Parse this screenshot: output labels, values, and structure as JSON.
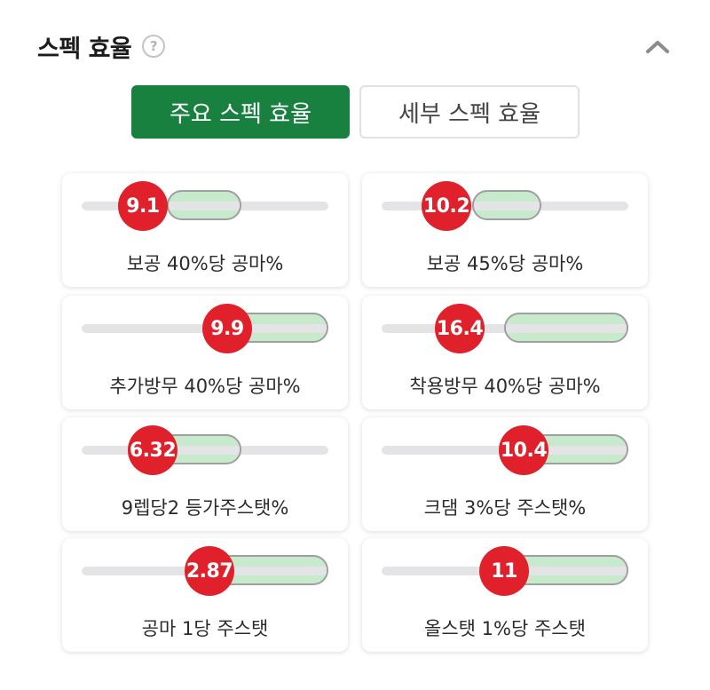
{
  "header": {
    "title": "스펙 효율",
    "help_icon": "?"
  },
  "tabs": [
    {
      "label": "주요 스펙 효율",
      "active": true
    },
    {
      "label": "세부 스펙 효율",
      "active": false
    }
  ],
  "colors": {
    "accent": "#19813f",
    "marker": "#e0202a",
    "range_fill": "#c8eacc"
  },
  "cards": [
    {
      "value": "9.1",
      "label": "보공 40%당 공마%"
    },
    {
      "value": "10.2",
      "label": "보공 45%당 공마%"
    },
    {
      "value": "9.9",
      "label": "추가방무 40%당 공마%"
    },
    {
      "value": "16.4",
      "label": "착용방무 40%당 공마%"
    },
    {
      "value": "6.32",
      "label": "9렙당2 등가주스탯%"
    },
    {
      "value": "10.4",
      "label": "크댐 3%당 주스탯%"
    },
    {
      "value": "2.87",
      "label": "공마 1당 주스탯"
    },
    {
      "value": "11",
      "label": "올스탯 1%당 주스탯"
    }
  ]
}
